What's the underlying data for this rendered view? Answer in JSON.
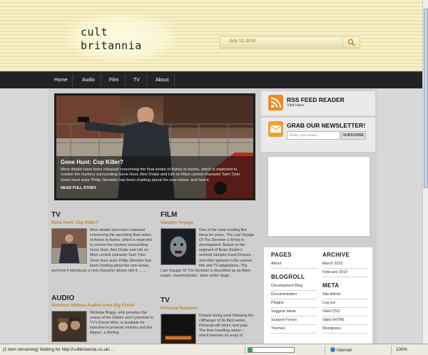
{
  "site": {
    "logo_line1": "cult",
    "logo_line2": "britannia",
    "date": "July 12, 2010"
  },
  "nav": {
    "items": [
      "Home",
      "Audio",
      "Film",
      "TV",
      "About"
    ]
  },
  "feature": {
    "title": "Gene Hunt: Cop Killer?",
    "text": "More details have been released concerning the final series of Ashes to Ashes, which is expected to resolve the mystery surrounding Gene Hunt, Alex Drake and Life on Mars central character Sam Tyler. Gene Hunt actor Philip Glenister has been chatting about the new series, and how it",
    "more": "READ FULL STORY"
  },
  "sections": {
    "tv": {
      "heading": "TV",
      "title": "Gene Hunt: Cop Killer?",
      "body": "More details have been released concerning the upcoming final series of Ashes to Ashes, which is expected to resolve the mystery surrounding Gene Hunt, Alex Drake and Life on Mars central character Sam Tyler. Gene Hunt actor Philip Glenister has been chatting about the new series, and how it introduces a new character whose role it .... ..."
    },
    "audio": {
      "heading": "AUDIO",
      "title": "Sherlock Holmes Audios from Big Finish",
      "body": "Nicholas Briggs, who provides the voices of the Daleks and Cybermen in TV's Doctor Who, is available for interview to promote 'Holmes and the Ripper', a thrilling"
    },
    "film": {
      "heading": "FILM",
      "title": "Vampire Voyage",
      "body": "One of the most exciting film ideas for years, The Last Voyage Of The Demeter is firmly in development. Based on the segment of Bram Stoker's seminal vampire novel Dracula – and often ignored in the various film and TV adaptations, The Last Voyage Of The Demeter is described as an Alien-esque, claustrophobic, 'base under siege'..."
    },
    "tv2": {
      "heading": "TV",
      "title": "Primeval Remains",
      "body": "Despite being axed following the cliffhanger of its third series, Primeval will return next year. The time travelling series – which features an array of"
    }
  },
  "sidebar": {
    "rss_title": "RSS FEED READER",
    "rss_sub": "Visit Here",
    "newsletter_title": "GRAB OUR NEWSLETTER!",
    "email_placeholder": "Enter your email...",
    "subscribe_label": "SUBSCRIBE",
    "pages": {
      "heading": "PAGES",
      "items": [
        "About"
      ]
    },
    "blogroll": {
      "heading": "BLOGROLL",
      "items": [
        "Development Blog",
        "Documentation",
        "Plugins",
        "Suggest Ideas",
        "Support Forum",
        "Themes"
      ]
    },
    "archive": {
      "heading": "ARCHIVE",
      "items": [
        "March 2010",
        "February 2010"
      ]
    },
    "meta": {
      "heading": "META",
      "items": [
        "Site Admin",
        "Log out",
        "Valid CSS",
        "Valid XHTML",
        "Wordpress"
      ]
    }
  },
  "statusbar": {
    "text": "(1 item remaining) Waiting for http://cultbritannia.co.uk/...",
    "zone": "Internet",
    "zoom": "100%",
    "progress": 0.1
  },
  "colors": {
    "accent": "#b8862d",
    "nav_bg": "#232323",
    "rss_orange": "#f08a24"
  }
}
